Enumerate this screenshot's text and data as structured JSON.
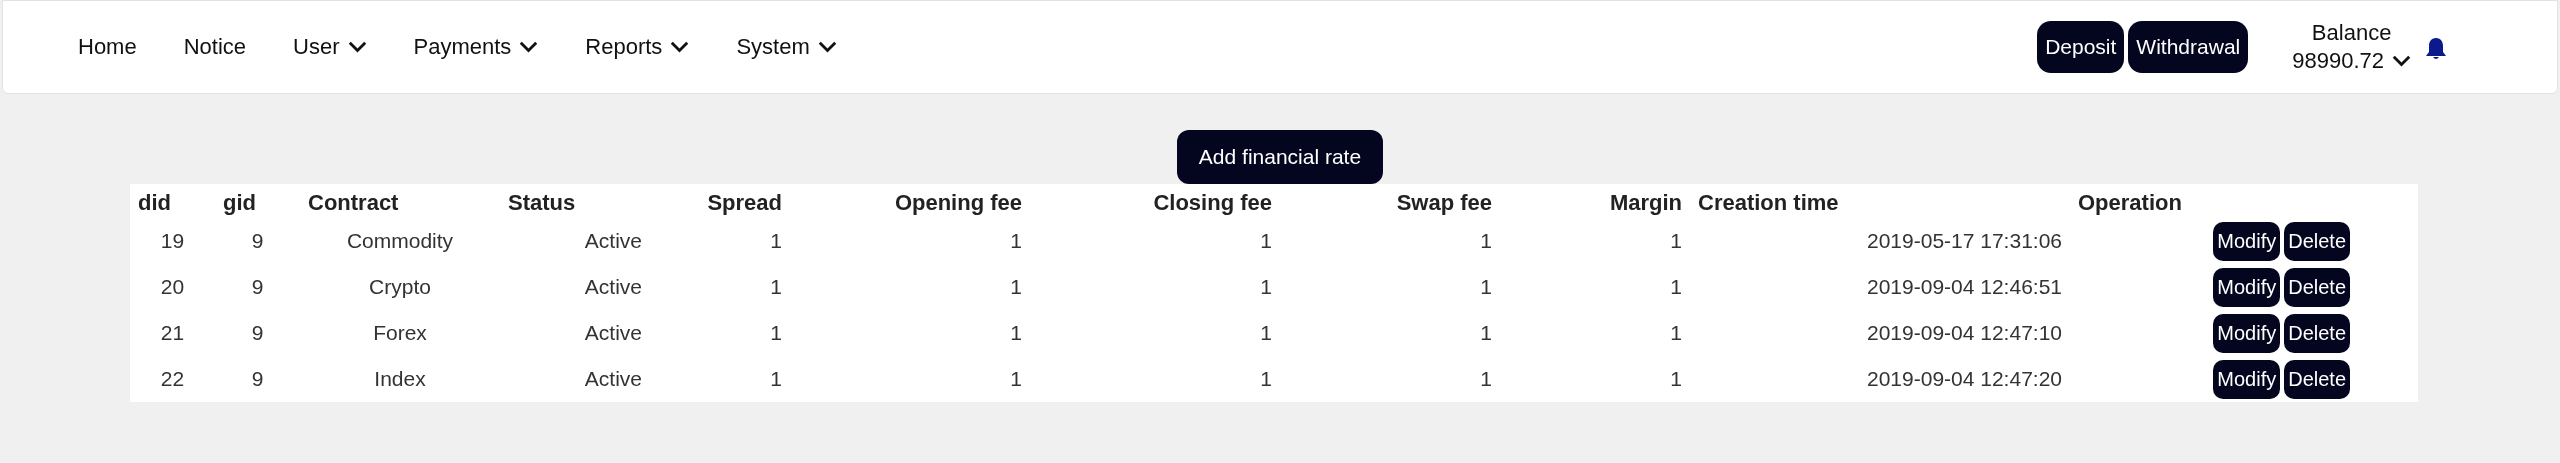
{
  "nav": {
    "items": [
      {
        "label": "Home",
        "dropdown": false
      },
      {
        "label": "Notice",
        "dropdown": false
      },
      {
        "label": "User",
        "dropdown": true
      },
      {
        "label": "Payments",
        "dropdown": true
      },
      {
        "label": "Reports",
        "dropdown": true
      },
      {
        "label": "System",
        "dropdown": true
      }
    ],
    "actions": [
      "Deposit",
      "Withdrawal"
    ],
    "balance": {
      "label": "Balance",
      "value": "98990.72"
    }
  },
  "add_button": "Add financial rate",
  "table": {
    "columns": [
      "did",
      "gid",
      "Contract",
      "Status",
      "Spread",
      "Opening fee",
      "Closing fee",
      "Swap fee",
      "Margin",
      "Creation time",
      "Operation"
    ],
    "rows": [
      {
        "cells": [
          "19",
          "9",
          "Commodity",
          "Active",
          "1",
          "1",
          "1",
          "1",
          "1",
          "2019-05-17 17:31:06"
        ],
        "actions": [
          "Modify",
          "Delete"
        ]
      },
      {
        "cells": [
          "20",
          "9",
          "Crypto",
          "Active",
          "1",
          "1",
          "1",
          "1",
          "1",
          "2019-09-04 12:46:51"
        ],
        "actions": [
          "Modify",
          "Delete"
        ]
      },
      {
        "cells": [
          "21",
          "9",
          "Forex",
          "Active",
          "1",
          "1",
          "1",
          "1",
          "1",
          "2019-09-04 12:47:10"
        ],
        "actions": [
          "Modify",
          "Delete"
        ]
      },
      {
        "cells": [
          "22",
          "9",
          "Index",
          "Active",
          "1",
          "1",
          "1",
          "1",
          "1",
          "2019-09-04 12:47:20"
        ],
        "actions": [
          "Modify",
          "Delete"
        ]
      }
    ]
  }
}
